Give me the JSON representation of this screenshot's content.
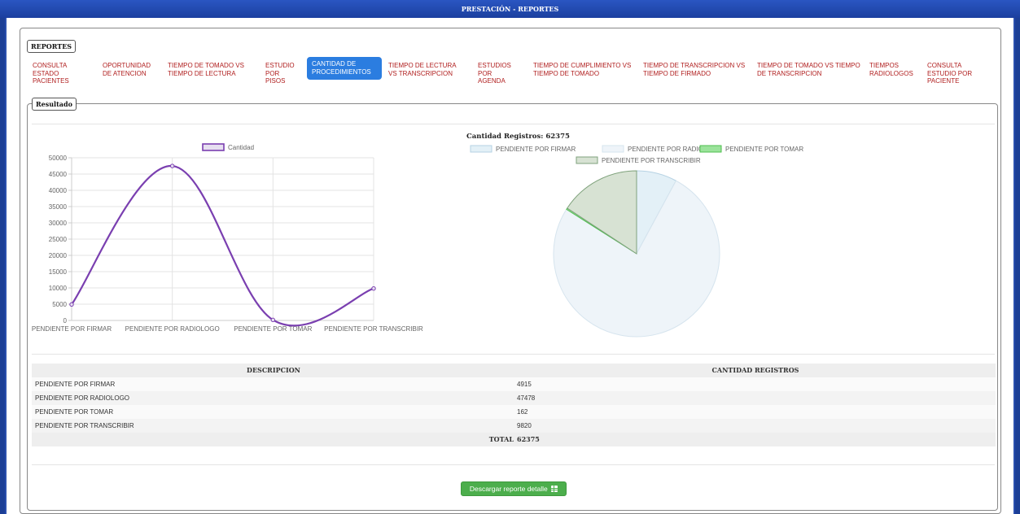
{
  "window": {
    "title": "PRESTACIÓN - REPORTES"
  },
  "reportes": {
    "legend": "REPORTES",
    "tabs": [
      {
        "label": "CONSULTA ESTADO PACIENTES"
      },
      {
        "label": "OPORTUNIDAD DE ATENCION"
      },
      {
        "label": "TIEMPO DE TOMADO VS TIEMPO DE LECTURA"
      },
      {
        "label": "ESTUDIO POR PISOS"
      },
      {
        "label": "CANTIDAD DE PROCEDIMIENTOS",
        "active": true
      },
      {
        "label": "TIEMPO DE LECTURA VS TRANSCRIPCION"
      },
      {
        "label": "ESTUDIOS POR AGENDA"
      },
      {
        "label": "TIEMPO DE CUMPLIMIENTO VS TIEMPO DE TOMADO"
      },
      {
        "label": "TIEMPO DE TRANSCRIPCION VS TIEMPO DE FIRMADO"
      },
      {
        "label": "TIEMPO DE TOMADO VS TIEMPO DE TRANSCRIPCION"
      },
      {
        "label": "TIEMPOS RADIOLOGOS"
      },
      {
        "label": "CONSULTA ESTUDIO POR PACIENTE"
      }
    ]
  },
  "resultado": {
    "legend": "Resultado",
    "pie_title": "Cantidad Registros: 62375",
    "table": {
      "headers": [
        "DESCRIPCION",
        "CANTIDAD REGISTROS"
      ],
      "rows": [
        [
          "PENDIENTE POR FIRMAR",
          "4915"
        ],
        [
          "PENDIENTE POR RADIOLOGO",
          "47478"
        ],
        [
          "PENDIENTE POR TOMAR",
          "162"
        ],
        [
          "PENDIENTE POR TRANSCRIBIR",
          "9820"
        ]
      ],
      "total_label": "TOTAL",
      "total_value": "62375"
    },
    "download_button": "Descargar reporte detalle"
  },
  "chart_data": [
    {
      "type": "line",
      "categories": [
        "PENDIENTE POR FIRMAR",
        "PENDIENTE POR RADIOLOGO",
        "PENDIENTE POR TOMAR",
        "PENDIENTE POR TRANSCRIBIR"
      ],
      "series": [
        {
          "name": "Cantidad",
          "values": [
            4915,
            47478,
            162,
            9820
          ],
          "color": "#7a3fb0"
        }
      ],
      "yticks": [
        0,
        5000,
        10000,
        15000,
        20000,
        25000,
        30000,
        35000,
        40000,
        45000,
        50000
      ],
      "ylim": [
        0,
        50000
      ],
      "legend": "top",
      "grid": true
    },
    {
      "type": "pie",
      "title": "Cantidad Registros: 62375",
      "labels": [
        "PENDIENTE POR FIRMAR",
        "PENDIENTE POR RADIOLOGO",
        "PENDIENTE POR TOMAR",
        "PENDIENTE POR TRANSCRIBIR"
      ],
      "values": [
        4915,
        47478,
        162,
        9820
      ],
      "colors": [
        "#e3f0f7",
        "#eef4f9",
        "#9be39b",
        "#d7e2d3"
      ],
      "borders": [
        "#b6d2e3",
        "#d6e4ee",
        "#4fbf4f",
        "#7fa27c"
      ],
      "legend": "top"
    }
  ]
}
